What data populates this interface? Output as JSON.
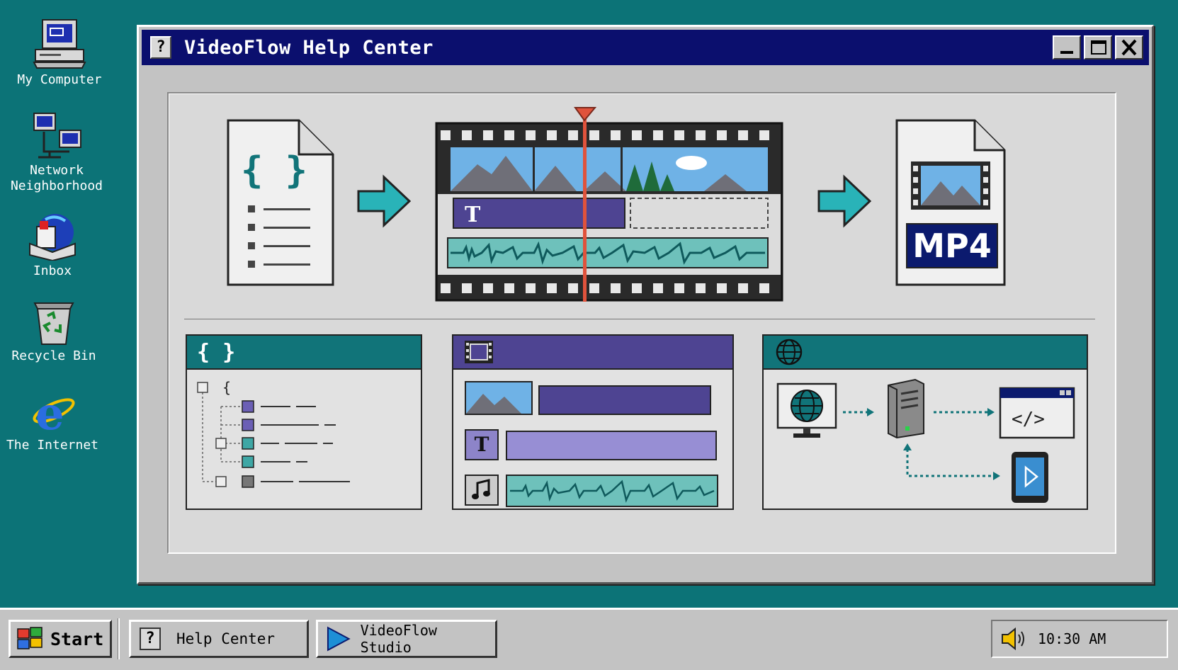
{
  "desktop": {
    "icons": [
      {
        "label": "My Computer"
      },
      {
        "label": "Network\nNeighborhood"
      },
      {
        "label": "Inbox"
      },
      {
        "label": "Recycle Bin"
      },
      {
        "label": "The Internet"
      }
    ]
  },
  "window": {
    "title": "VideoFlow Help Center",
    "icon_glyph": "?",
    "controls": [
      "minimize-icon",
      "maximize-icon",
      "close-icon"
    ]
  },
  "diagram": {
    "input_glyph": "{ }",
    "timeline_text_glyph": "T",
    "output_label": "MP4",
    "json_panel_glyph": "{ }",
    "json_tree_brace": "{",
    "text_track_glyph": "T"
  },
  "taskbar": {
    "start_label": "Start",
    "tasks": [
      {
        "label": "Help Center",
        "icon": "help-icon"
      },
      {
        "label": "VideoFlow Studio",
        "icon": "play-icon"
      }
    ],
    "clock": "10:30 AM"
  },
  "colors": {
    "desktop": "#0c7377",
    "titlebar": "#0b0f6e",
    "teal": "#117479",
    "purple": "#4e4492",
    "accent_red": "#e0533c"
  }
}
